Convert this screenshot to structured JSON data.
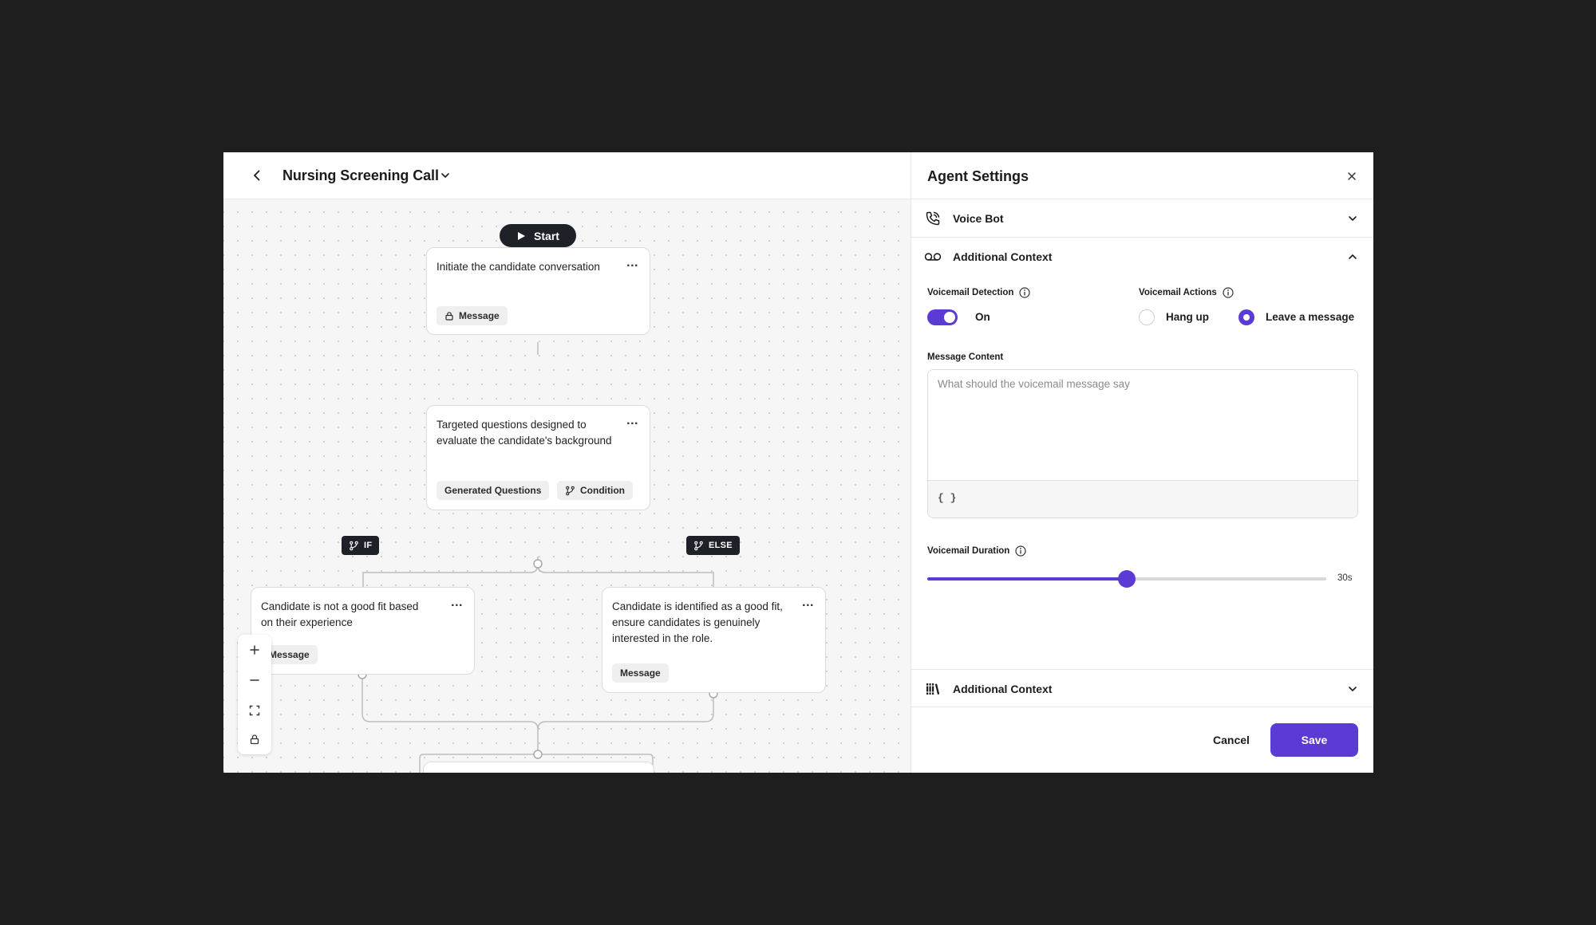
{
  "header": {
    "flow_title": "Nursing Screening Call"
  },
  "flow": {
    "start_label": "Start",
    "nodes": [
      {
        "text": "Initiate the candidate conversation",
        "chips": [
          "Message"
        ]
      },
      {
        "text": "Targeted questions designed to evaluate the candidate's background",
        "chips": [
          "Generated Questions",
          "Condition"
        ]
      },
      {
        "text": "Candidate is not a good fit based on their experience",
        "chips": [
          "Message"
        ]
      },
      {
        "text": "Candidate is identified as a good fit, ensure candidates is genuinely interested in the role.",
        "chips": [
          "Message"
        ]
      }
    ],
    "more_label": "...",
    "branch_if": "IF",
    "branch_else": "ELSE"
  },
  "panel": {
    "title": "Agent Settings",
    "sections": {
      "voice_bot": "Voice Bot",
      "additional_context": "Additional Context",
      "additional_context_2": "Additional Context"
    },
    "voicemail_detection": {
      "label": "Voicemail Detection",
      "state_text": "On",
      "enabled": true
    },
    "voicemail_actions": {
      "label": "Voicemail Actions",
      "options": [
        "Hang up",
        "Leave a message"
      ],
      "selected": "Leave a message"
    },
    "message_content": {
      "label": "Message Content",
      "placeholder": "What should the voicemail message say",
      "value": "",
      "variable_button": "{ }"
    },
    "voicemail_duration": {
      "label": "Voicemail Duration",
      "value_text": "30s",
      "fraction": 0.5
    },
    "buttons": {
      "cancel": "Cancel",
      "save": "Save"
    }
  },
  "colors": {
    "accent": "#5b3bd4",
    "dark": "#1e2128",
    "backdrop": "#1e1e1e"
  },
  "icons": [
    "back-arrow-icon",
    "chevron-down-icon",
    "play-icon",
    "lock-icon",
    "branch-icon",
    "plus-icon",
    "minus-icon",
    "fit-view-icon",
    "close-icon",
    "phone-icon",
    "voicemail-icon",
    "info-icon",
    "chevron-up-icon",
    "library-icon",
    "braces-icon"
  ]
}
